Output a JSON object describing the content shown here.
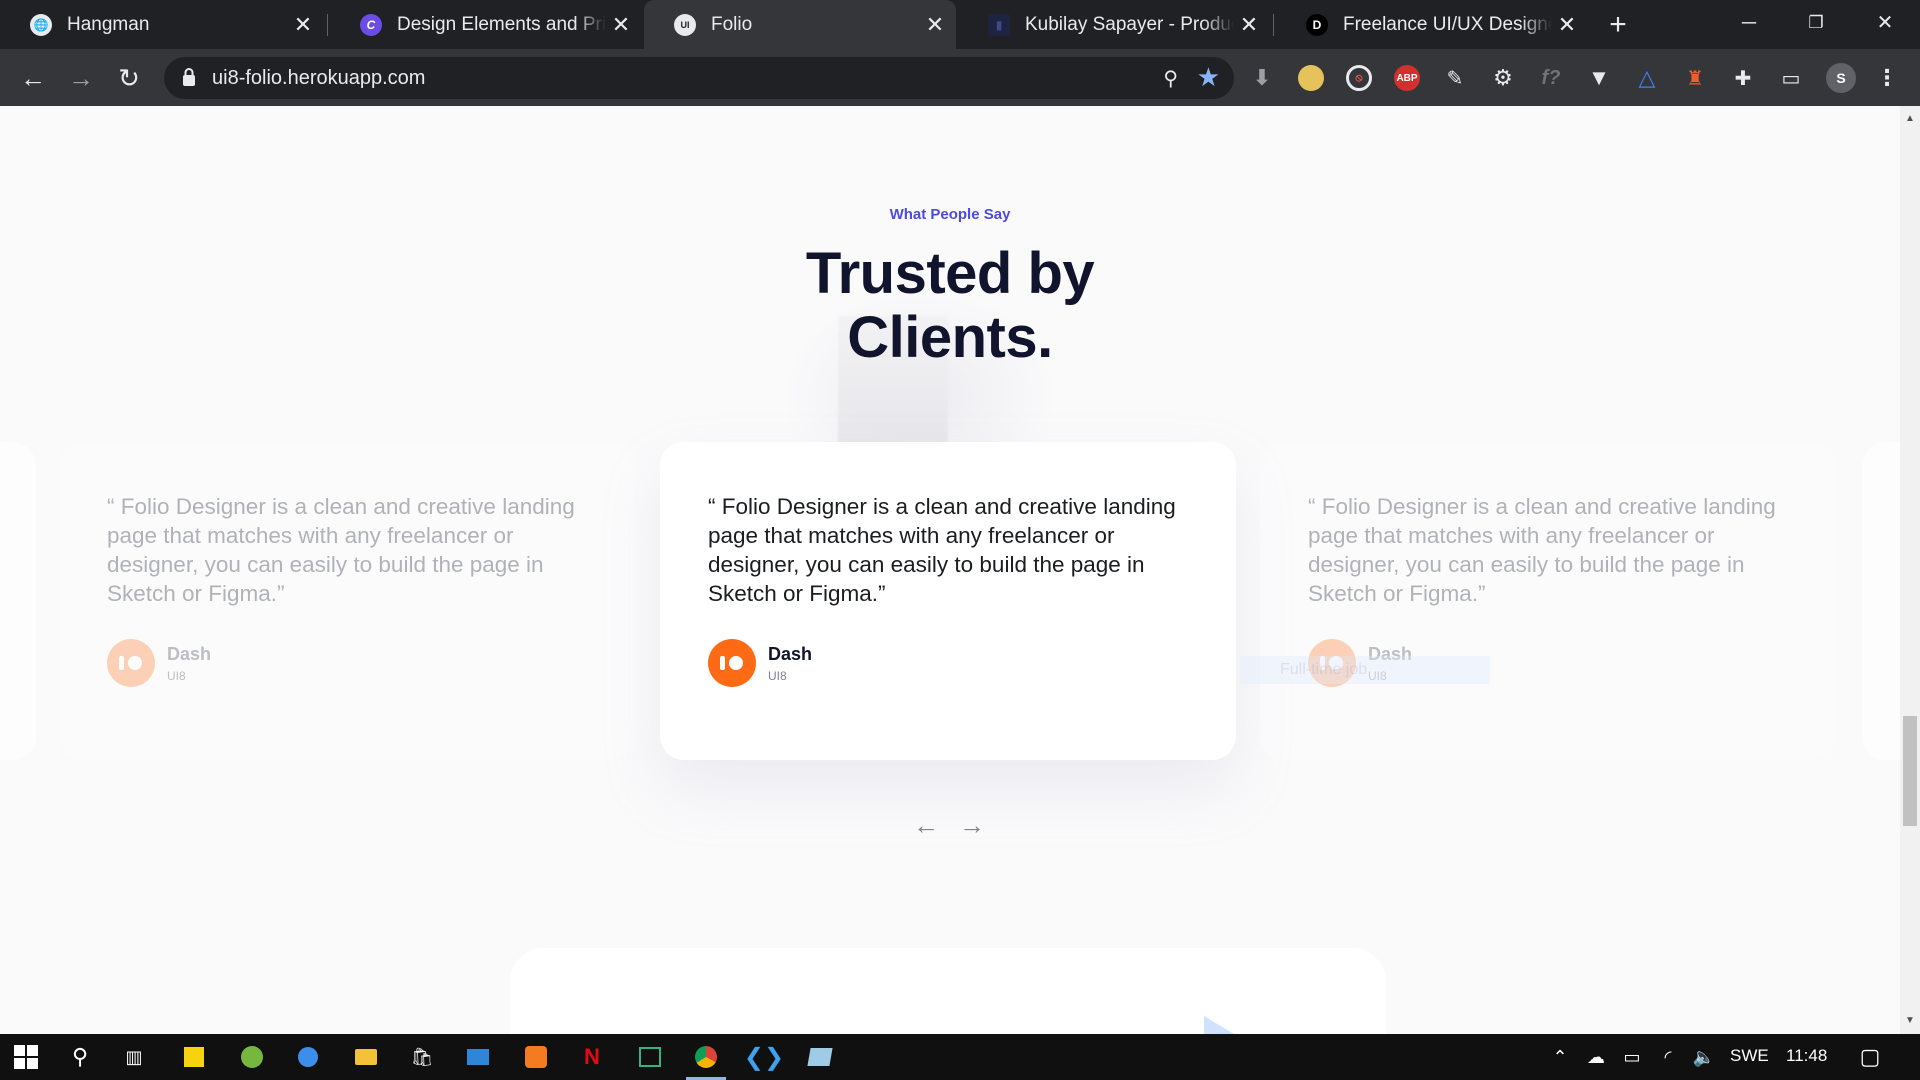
{
  "browser": {
    "tabs": [
      {
        "title": "Hangman",
        "icon": "globe-icon"
      },
      {
        "title": "Design Elements and Principles",
        "icon": "canva-icon"
      },
      {
        "title": "Folio",
        "icon": "ui8-icon",
        "active": true
      },
      {
        "title": "Kubilay Sapayer - Product Designer",
        "icon": "site-icon"
      },
      {
        "title": "Freelance UI/UX Designer",
        "icon": "d-icon"
      }
    ],
    "url": "ui8-folio.herokuapp.com",
    "extensions": [
      "download-icon",
      "shield-icon",
      "block-icon",
      "ABP",
      "pen-icon",
      "gear-icon",
      "formula-icon",
      "vuetify-icon",
      "drive-icon",
      "lighthouse-icon",
      "puzzle-icon",
      "cast-icon"
    ],
    "profile_initial": "S"
  },
  "section": {
    "eyebrow": "What People Say",
    "heading_line1": "Trusted by",
    "heading_line2": "Clients."
  },
  "testimonials": [
    {
      "quote": "“ Folio Designer is a clean and creative landing page that matches with any freelancer or designer, you can easily to build the page in Sketch or Figma.”",
      "name": "Dash",
      "role": "UI8"
    },
    {
      "quote": "“ Folio Designer is a clean and creative landing page that matches with any freelancer or designer, you can easily to build the page in Sketch or Figma.”",
      "name": "Dash",
      "role": "UI8"
    },
    {
      "quote": "“ Folio Designer is a clean and creative landing page that matches with any freelancer or designer, you can easily to build the page in Sketch or Figma.”",
      "name": "Dash",
      "role": "UI8"
    }
  ],
  "ghost_label": "Full-time job",
  "carousel": {
    "prev": "←",
    "next": "→"
  },
  "taskbar": {
    "language": "SWE",
    "time": "11:48"
  },
  "colors": {
    "accent": "#4c4bdb",
    "avatar": "#ff6a14",
    "heading": "#11142d"
  }
}
